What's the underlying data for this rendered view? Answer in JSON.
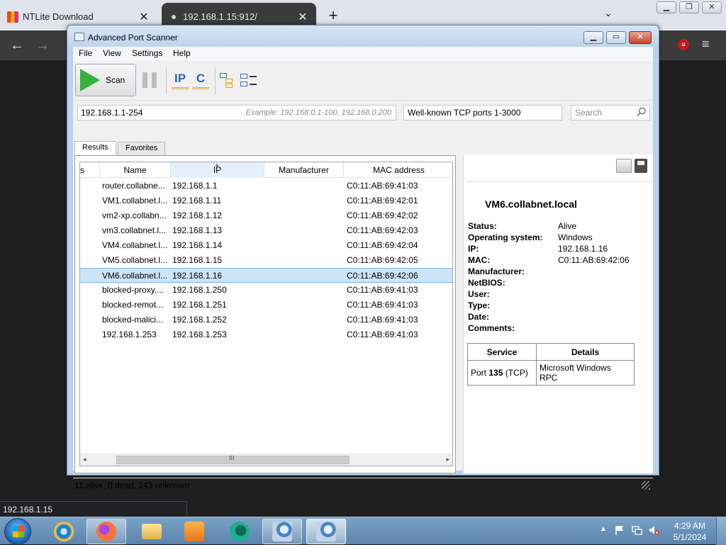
{
  "browser": {
    "tabs": [
      {
        "title": "NTLite Download",
        "close": "✕"
      },
      {
        "title": "192.168.1.15:912/",
        "close": "✕"
      }
    ],
    "new_tab": "+",
    "tab_list": "⌄",
    "nav": {
      "back": "←",
      "forward": "→"
    },
    "menu": "≡",
    "extension_badge": "u",
    "status_url": "192.168.1.15"
  },
  "app": {
    "title": "Advanced Port Scanner",
    "menu": [
      "File",
      "View",
      "Settings",
      "Help"
    ],
    "scan_label": "Scan",
    "toolbar_icons": {
      "ip": "IP",
      "class_c": "C"
    },
    "range_value": "192.168.1.1-254",
    "range_example": "Example: 192.168.0.1-100, 192.168.0.200",
    "ports_value": "Well-known TCP ports 1-3000",
    "search_placeholder": "Search",
    "tabs": [
      "Results",
      "Favorites"
    ],
    "columns": {
      "status_fragment": "s",
      "name": "Name",
      "ip": "IP",
      "manufacturer": "Manufacturer",
      "mac": "MAC address"
    },
    "rows": [
      {
        "name": "router.collabne...",
        "ip": "192.168.1.1",
        "mac": "C0:11:AB:69:41:03"
      },
      {
        "name": "VM1.collabnet.l...",
        "ip": "192.168.1.11",
        "mac": "C0:11:AB:69:42:01"
      },
      {
        "name": "vm2-xp.collabn...",
        "ip": "192.168.1.12",
        "mac": "C0:11:AB:69:42:02"
      },
      {
        "name": "vm3.collabnet.l...",
        "ip": "192.168.1.13",
        "mac": "C0:11:AB:69:42:03"
      },
      {
        "name": "VM4.collabnet.l...",
        "ip": "192.168.1.14",
        "mac": "C0:11:AB:69:42:04"
      },
      {
        "name": "VM5.collabnet.l...",
        "ip": "192.168.1.15",
        "mac": "C0:11:AB:69:42:05"
      },
      {
        "name": "VM6.collabnet.l...",
        "ip": "192.168.1.16",
        "mac": "C0:11:AB:69:42:06"
      },
      {
        "name": "blocked-proxy....",
        "ip": "192.168.1.250",
        "mac": "C0:11:AB:69:41:03"
      },
      {
        "name": "blocked-remot...",
        "ip": "192.168.1.251",
        "mac": "C0:11:AB:69:41:03"
      },
      {
        "name": "blocked-malici...",
        "ip": "192.168.1.252",
        "mac": "C0:11:AB:69:41:03"
      },
      {
        "name": "192.168.1.253",
        "ip": "192.168.1.253",
        "mac": "C0:11:AB:69:41:03"
      }
    ],
    "selected_row_index": 6,
    "scrollbar": {
      "left": "◂",
      "right": "▸",
      "grip": "III"
    },
    "details": {
      "host": "VM6.collabnet.local",
      "labels": {
        "status": "Status:",
        "os": "Operating system:",
        "ip": "IP:",
        "mac": "MAC:",
        "manufacturer": "Manufacturer:",
        "netbios": "NetBIOS:",
        "user": "User:",
        "type": "Type:",
        "date": "Date:",
        "comments": "Comments:"
      },
      "values": {
        "status": "Alive",
        "os": "Windows",
        "ip": "192.168.1.16",
        "mac": "C0:11:AB:69:42:06"
      },
      "services_header": {
        "service": "Service",
        "details": "Details"
      },
      "services": [
        {
          "port_prefix": "Port ",
          "port": "135",
          "proto": " (TCP)",
          "details": "Microsoft Windows RPC"
        }
      ]
    },
    "status_text": "11 alive, 0 dead, 243 unknown"
  },
  "taskbar": {
    "time": "4:29 AM",
    "date": "5/1/2024",
    "tray_up": "▲"
  },
  "colors": {
    "accent_green": "#35b13d",
    "selection": "#cce4f7",
    "toolbar_blue": "#2d63b5",
    "taskbar": "#5b84ac"
  }
}
